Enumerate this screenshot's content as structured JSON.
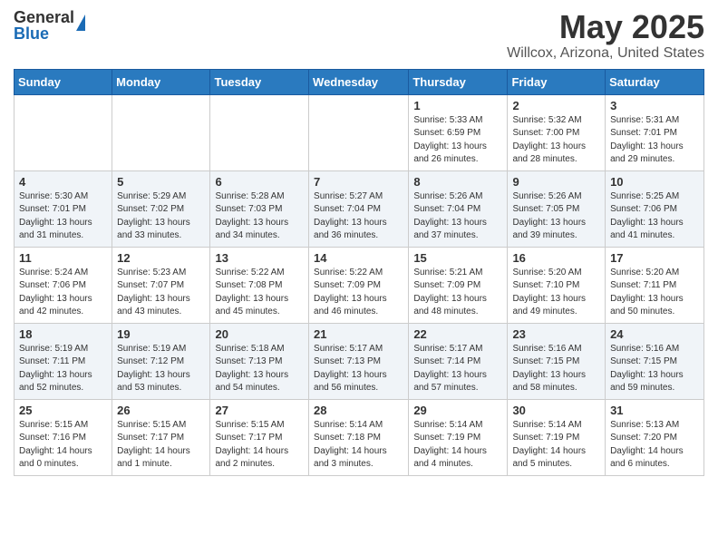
{
  "header": {
    "logo_general": "General",
    "logo_blue": "Blue",
    "title": "May 2025",
    "subtitle": "Willcox, Arizona, United States"
  },
  "calendar": {
    "days_of_week": [
      "Sunday",
      "Monday",
      "Tuesday",
      "Wednesday",
      "Thursday",
      "Friday",
      "Saturday"
    ],
    "weeks": [
      [
        {
          "day": "",
          "info": ""
        },
        {
          "day": "",
          "info": ""
        },
        {
          "day": "",
          "info": ""
        },
        {
          "day": "",
          "info": ""
        },
        {
          "day": "1",
          "info": "Sunrise: 5:33 AM\nSunset: 6:59 PM\nDaylight: 13 hours\nand 26 minutes."
        },
        {
          "day": "2",
          "info": "Sunrise: 5:32 AM\nSunset: 7:00 PM\nDaylight: 13 hours\nand 28 minutes."
        },
        {
          "day": "3",
          "info": "Sunrise: 5:31 AM\nSunset: 7:01 PM\nDaylight: 13 hours\nand 29 minutes."
        }
      ],
      [
        {
          "day": "4",
          "info": "Sunrise: 5:30 AM\nSunset: 7:01 PM\nDaylight: 13 hours\nand 31 minutes."
        },
        {
          "day": "5",
          "info": "Sunrise: 5:29 AM\nSunset: 7:02 PM\nDaylight: 13 hours\nand 33 minutes."
        },
        {
          "day": "6",
          "info": "Sunrise: 5:28 AM\nSunset: 7:03 PM\nDaylight: 13 hours\nand 34 minutes."
        },
        {
          "day": "7",
          "info": "Sunrise: 5:27 AM\nSunset: 7:04 PM\nDaylight: 13 hours\nand 36 minutes."
        },
        {
          "day": "8",
          "info": "Sunrise: 5:26 AM\nSunset: 7:04 PM\nDaylight: 13 hours\nand 37 minutes."
        },
        {
          "day": "9",
          "info": "Sunrise: 5:26 AM\nSunset: 7:05 PM\nDaylight: 13 hours\nand 39 minutes."
        },
        {
          "day": "10",
          "info": "Sunrise: 5:25 AM\nSunset: 7:06 PM\nDaylight: 13 hours\nand 41 minutes."
        }
      ],
      [
        {
          "day": "11",
          "info": "Sunrise: 5:24 AM\nSunset: 7:06 PM\nDaylight: 13 hours\nand 42 minutes."
        },
        {
          "day": "12",
          "info": "Sunrise: 5:23 AM\nSunset: 7:07 PM\nDaylight: 13 hours\nand 43 minutes."
        },
        {
          "day": "13",
          "info": "Sunrise: 5:22 AM\nSunset: 7:08 PM\nDaylight: 13 hours\nand 45 minutes."
        },
        {
          "day": "14",
          "info": "Sunrise: 5:22 AM\nSunset: 7:09 PM\nDaylight: 13 hours\nand 46 minutes."
        },
        {
          "day": "15",
          "info": "Sunrise: 5:21 AM\nSunset: 7:09 PM\nDaylight: 13 hours\nand 48 minutes."
        },
        {
          "day": "16",
          "info": "Sunrise: 5:20 AM\nSunset: 7:10 PM\nDaylight: 13 hours\nand 49 minutes."
        },
        {
          "day": "17",
          "info": "Sunrise: 5:20 AM\nSunset: 7:11 PM\nDaylight: 13 hours\nand 50 minutes."
        }
      ],
      [
        {
          "day": "18",
          "info": "Sunrise: 5:19 AM\nSunset: 7:11 PM\nDaylight: 13 hours\nand 52 minutes."
        },
        {
          "day": "19",
          "info": "Sunrise: 5:19 AM\nSunset: 7:12 PM\nDaylight: 13 hours\nand 53 minutes."
        },
        {
          "day": "20",
          "info": "Sunrise: 5:18 AM\nSunset: 7:13 PM\nDaylight: 13 hours\nand 54 minutes."
        },
        {
          "day": "21",
          "info": "Sunrise: 5:17 AM\nSunset: 7:13 PM\nDaylight: 13 hours\nand 56 minutes."
        },
        {
          "day": "22",
          "info": "Sunrise: 5:17 AM\nSunset: 7:14 PM\nDaylight: 13 hours\nand 57 minutes."
        },
        {
          "day": "23",
          "info": "Sunrise: 5:16 AM\nSunset: 7:15 PM\nDaylight: 13 hours\nand 58 minutes."
        },
        {
          "day": "24",
          "info": "Sunrise: 5:16 AM\nSunset: 7:15 PM\nDaylight: 13 hours\nand 59 minutes."
        }
      ],
      [
        {
          "day": "25",
          "info": "Sunrise: 5:15 AM\nSunset: 7:16 PM\nDaylight: 14 hours\nand 0 minutes."
        },
        {
          "day": "26",
          "info": "Sunrise: 5:15 AM\nSunset: 7:17 PM\nDaylight: 14 hours\nand 1 minute."
        },
        {
          "day": "27",
          "info": "Sunrise: 5:15 AM\nSunset: 7:17 PM\nDaylight: 14 hours\nand 2 minutes."
        },
        {
          "day": "28",
          "info": "Sunrise: 5:14 AM\nSunset: 7:18 PM\nDaylight: 14 hours\nand 3 minutes."
        },
        {
          "day": "29",
          "info": "Sunrise: 5:14 AM\nSunset: 7:19 PM\nDaylight: 14 hours\nand 4 minutes."
        },
        {
          "day": "30",
          "info": "Sunrise: 5:14 AM\nSunset: 7:19 PM\nDaylight: 14 hours\nand 5 minutes."
        },
        {
          "day": "31",
          "info": "Sunrise: 5:13 AM\nSunset: 7:20 PM\nDaylight: 14 hours\nand 6 minutes."
        }
      ]
    ]
  }
}
